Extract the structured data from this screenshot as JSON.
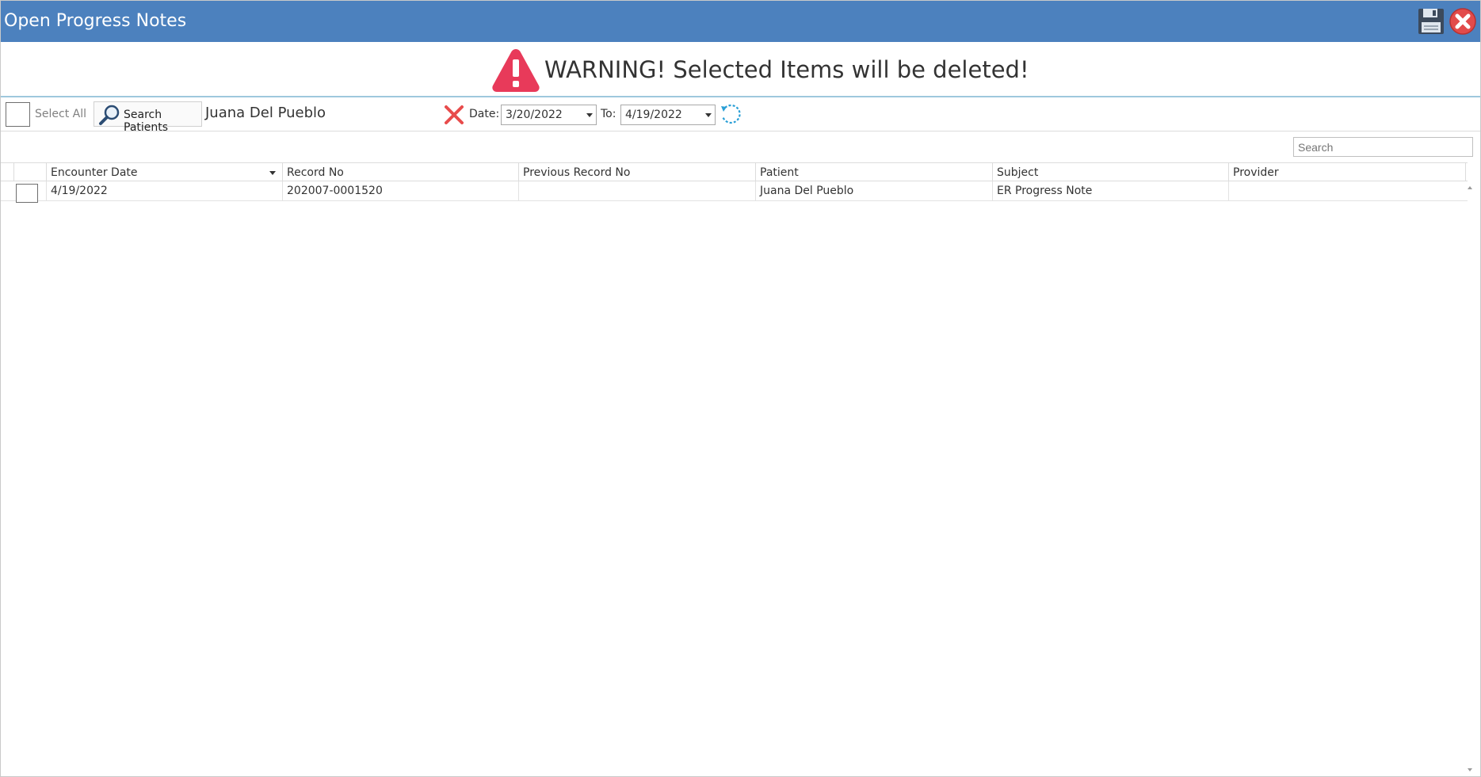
{
  "window": {
    "title": "Open Progress Notes"
  },
  "icons": {
    "save": "save-icon",
    "close": "close-icon",
    "warning": "warning-triangle-icon",
    "search": "magnifier-icon",
    "clear": "clear-x-icon",
    "refresh": "refresh-icon"
  },
  "colors": {
    "titlebar": "#4c81be",
    "warning_icon": "#e83a5a",
    "close_button": "#e24b4b",
    "clear_x": "#e84c4c",
    "refresh": "#2a9fd6"
  },
  "warning": {
    "text": "WARNING! Selected Items will be deleted!"
  },
  "toolbar": {
    "select_all_label": "Select All",
    "search_patients_label": "Search Patients",
    "patient_name": "Juana Del Pueblo",
    "date_label": "Date:",
    "date_from": "3/20/2022",
    "to_label": "To:",
    "date_to": "4/19/2022"
  },
  "search": {
    "placeholder": "Search"
  },
  "grid": {
    "columns": [
      "Encounter Date",
      "Record No",
      "Previous Record No",
      "Patient",
      "Subject",
      "Provider"
    ],
    "rows": [
      {
        "encounter_date": "4/19/2022",
        "record_no": "202007-0001520",
        "previous_record_no": "",
        "patient": "Juana Del Pueblo",
        "subject": "ER Progress Note",
        "provider": ""
      }
    ]
  }
}
